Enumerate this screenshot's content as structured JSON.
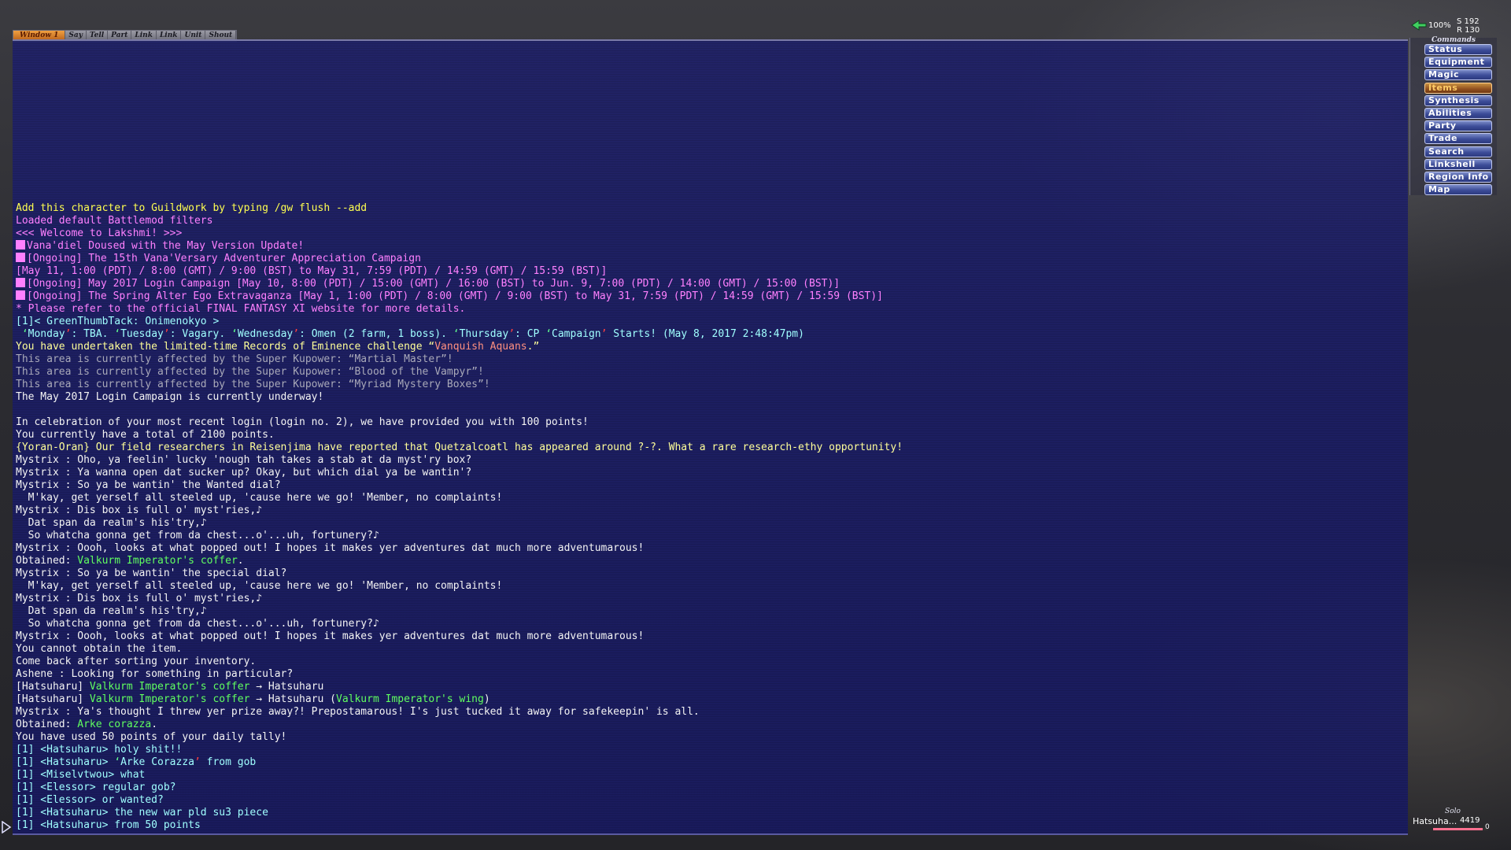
{
  "tabs": [
    {
      "label": "Window 1",
      "active": true
    },
    {
      "label": "Say",
      "active": false
    },
    {
      "label": "Tell",
      "active": false
    },
    {
      "label": "Part",
      "active": false
    },
    {
      "label": "Link",
      "active": false
    },
    {
      "label": "Link",
      "active": false
    },
    {
      "label": "Unit",
      "active": false
    },
    {
      "label": "Shout",
      "active": false
    }
  ],
  "hud": {
    "percent": "100%",
    "s_value": "S 192",
    "r_value": "R 130"
  },
  "commands": {
    "title": "Commands",
    "items": [
      {
        "label": "Status",
        "selected": false
      },
      {
        "label": "Equipment",
        "selected": false
      },
      {
        "label": "Magic",
        "selected": false
      },
      {
        "label": "Items",
        "selected": true
      },
      {
        "label": "Synthesis",
        "selected": false
      },
      {
        "label": "Abilities",
        "selected": false
      },
      {
        "label": "Party",
        "selected": false
      },
      {
        "label": "Trade",
        "selected": false
      },
      {
        "label": "Search",
        "selected": false
      },
      {
        "label": "Linkshell",
        "selected": false
      },
      {
        "label": "Region Info",
        "selected": false
      },
      {
        "label": "Map",
        "selected": false
      }
    ]
  },
  "party": {
    "title": "Solo",
    "name": "Hatsuha...",
    "hp": "4419",
    "hp_fraction": 0.9,
    "tp": "0"
  },
  "chat_lines": [
    {
      "segments": [
        {
          "text": "Add this character to Guildwork by typing /gw flush --add",
          "color": "yellow"
        }
      ]
    },
    {
      "segments": [
        {
          "text": "Loaded default Battlemod filters",
          "color": "magenta"
        }
      ]
    },
    {
      "segments": [
        {
          "text": "<<< Welcome to Lakshmi! >>>",
          "color": "magenta"
        }
      ]
    },
    {
      "bullet": true,
      "segments": [
        {
          "text": "Vana'diel Doused with the May Version Update!",
          "color": "magenta"
        }
      ]
    },
    {
      "bullet": true,
      "segments": [
        {
          "text": "[Ongoing] The 15th Vana'Versary Adventurer Appreciation Campaign",
          "color": "magenta"
        }
      ]
    },
    {
      "segments": [
        {
          "text": "[May 11, 1:00 (PDT) / 8:00 (GMT) / 9:00 (BST) to May 31, 7:59 (PDT) / 14:59 (GMT) / 15:59 (BST)]",
          "color": "magenta"
        }
      ]
    },
    {
      "bullet": true,
      "segments": [
        {
          "text": "[Ongoing] May 2017 Login Campaign [May 10, 8:00 (PDT) / 15:00 (GMT) / 16:00 (BST) to Jun. 9, 7:00 (PDT) / 14:00 (GMT) / 15:00 (BST)]",
          "color": "magenta"
        }
      ]
    },
    {
      "bullet": true,
      "segments": [
        {
          "text": "[Ongoing] The Spring Alter Ego Extravaganza [May 1, 1:00 (PDT) / 8:00 (GMT) / 9:00 (BST) to May 31, 7:59 (PDT) / 14:59 (GMT) / 15:59 (BST)]",
          "color": "magenta"
        }
      ]
    },
    {
      "segments": [
        {
          "text": "* Please refer to the official FINAL FANTASY XI website for more details.",
          "color": "magenta"
        }
      ]
    },
    {
      "segments": [
        {
          "text": "[1]< GreenThumbTack: Onimenokyo >",
          "color": "cyan"
        }
      ]
    },
    {
      "segments": [
        {
          "text": " ",
          "color": "cyan"
        },
        {
          "text": "‘",
          "color": "mag-green"
        },
        {
          "text": "Monday",
          "color": "cyan"
        },
        {
          "text": "’",
          "color": "red"
        },
        {
          "text": ": TBA. ",
          "color": "cyan"
        },
        {
          "text": "‘",
          "color": "mag-green"
        },
        {
          "text": "Tuesday",
          "color": "cyan"
        },
        {
          "text": "’",
          "color": "red"
        },
        {
          "text": ": Vagary. ",
          "color": "cyan"
        },
        {
          "text": "‘",
          "color": "mag-green"
        },
        {
          "text": "Wednesday",
          "color": "cyan"
        },
        {
          "text": "’",
          "color": "red"
        },
        {
          "text": ": Omen (2 farm, 1 boss). ",
          "color": "cyan"
        },
        {
          "text": "‘",
          "color": "mag-green"
        },
        {
          "text": "Thursday",
          "color": "cyan"
        },
        {
          "text": "’",
          "color": "red"
        },
        {
          "text": ": CP ",
          "color": "cyan"
        },
        {
          "text": "‘",
          "color": "mag-green"
        },
        {
          "text": "Campaign",
          "color": "cyan"
        },
        {
          "text": "’",
          "color": "red"
        },
        {
          "text": " Starts! (May 8, 2017 2:48:47pm)",
          "color": "cyan"
        }
      ]
    },
    {
      "segments": [
        {
          "text": "You have undertaken the limited-time Records of Eminence challenge “",
          "color": "lightyellow"
        },
        {
          "text": "Vanquish Aquans",
          "color": "salmon"
        },
        {
          "text": ".”",
          "color": "lightyellow"
        }
      ]
    },
    {
      "segments": [
        {
          "text": "This area is currently affected by the Super Kupower: “Martial Master”!",
          "color": "gray"
        }
      ]
    },
    {
      "segments": [
        {
          "text": "This area is currently affected by the Super Kupower: “Blood of the Vampyr”!",
          "color": "gray"
        }
      ]
    },
    {
      "segments": [
        {
          "text": "This area is currently affected by the Super Kupower: “Myriad Mystery Boxes”!",
          "color": "gray"
        }
      ]
    },
    {
      "segments": [
        {
          "text": "The May 2017 Login Campaign is currently underway!",
          "color": "white"
        }
      ]
    },
    {
      "segments": [
        {
          "text": "",
          "color": "white"
        }
      ]
    },
    {
      "segments": [
        {
          "text": "In celebration of your most recent login (login no. 2), we have provided you with 100 points!",
          "color": "white"
        }
      ]
    },
    {
      "segments": [
        {
          "text": "You currently have a total of 2100 points.",
          "color": "white"
        }
      ]
    },
    {
      "segments": [
        {
          "text": "{Yoran-Oran} Our field researchers in Reisenjima have reported that Quetzalcoatl has appeared around ?-?. What a rare research-ethy opportunity!",
          "color": "lightyellow"
        }
      ]
    },
    {
      "segments": [
        {
          "text": "Mystrix : Oho, ya feelin' lucky 'nough tah takes a stab at da myst'ry box?",
          "color": "white"
        }
      ]
    },
    {
      "segments": [
        {
          "text": "Mystrix : Ya wanna open dat sucker up? Okay, but which dial ya be wantin'?",
          "color": "white"
        }
      ]
    },
    {
      "segments": [
        {
          "text": "Mystrix : So ya be wantin' the Wanted dial?",
          "color": "white"
        }
      ]
    },
    {
      "segments": [
        {
          "text": "  M'kay, get yerself all steeled up, 'cause here we go! 'Member, no complaints!",
          "color": "white"
        }
      ]
    },
    {
      "segments": [
        {
          "text": "Mystrix : Dis box is full o' myst'ries,♪",
          "color": "white"
        }
      ]
    },
    {
      "segments": [
        {
          "text": "  Dat span da realm's his'try,♪",
          "color": "white"
        }
      ]
    },
    {
      "segments": [
        {
          "text": "  So whatcha gonna get from da chest...o'...uh, fortunery?♪",
          "color": "white"
        }
      ]
    },
    {
      "segments": [
        {
          "text": "Mystrix : Oooh, looks at what popped out! I hopes it makes yer adventures dat much more adventumarous!",
          "color": "white"
        }
      ]
    },
    {
      "segments": [
        {
          "text": "Obtained: ",
          "color": "white"
        },
        {
          "text": "Valkurm Imperator's coffer",
          "color": "green"
        },
        {
          "text": ".",
          "color": "white"
        }
      ]
    },
    {
      "segments": [
        {
          "text": "Mystrix : So ya be wantin' the special dial?",
          "color": "white"
        }
      ]
    },
    {
      "segments": [
        {
          "text": "  M'kay, get yerself all steeled up, 'cause here we go! 'Member, no complaints!",
          "color": "white"
        }
      ]
    },
    {
      "segments": [
        {
          "text": "Mystrix : Dis box is full o' myst'ries,♪",
          "color": "white"
        }
      ]
    },
    {
      "segments": [
        {
          "text": "  Dat span da realm's his'try,♪",
          "color": "white"
        }
      ]
    },
    {
      "segments": [
        {
          "text": "  So whatcha gonna get from da chest...o'...uh, fortunery?♪",
          "color": "white"
        }
      ]
    },
    {
      "segments": [
        {
          "text": "Mystrix : Oooh, looks at what popped out! I hopes it makes yer adventures dat much more adventumarous!",
          "color": "white"
        }
      ]
    },
    {
      "segments": [
        {
          "text": "You cannot obtain the item.",
          "color": "white"
        }
      ]
    },
    {
      "segments": [
        {
          "text": "Come back after sorting your inventory.",
          "color": "white"
        }
      ]
    },
    {
      "segments": [
        {
          "text": "Ashene : Looking for something in particular?",
          "color": "white"
        }
      ]
    },
    {
      "segments": [
        {
          "text": "[Hatsuharu] ",
          "color": "white"
        },
        {
          "text": "Valkurm Imperator's coffer",
          "color": "green"
        },
        {
          "text": " → Hatsuharu",
          "color": "white"
        }
      ]
    },
    {
      "segments": [
        {
          "text": "[Hatsuharu] ",
          "color": "white"
        },
        {
          "text": "Valkurm Imperator's coffer",
          "color": "green"
        },
        {
          "text": " → Hatsuharu (",
          "color": "white"
        },
        {
          "text": "Valkurm Imperator's wing",
          "color": "green"
        },
        {
          "text": ")",
          "color": "white"
        }
      ]
    },
    {
      "segments": [
        {
          "text": "Mystrix : Ya's thought I threw yer prize away?! Prepostamarous! I's just tucked it away for safekeepin' is all.",
          "color": "white"
        }
      ]
    },
    {
      "segments": [
        {
          "text": "Obtained: ",
          "color": "white"
        },
        {
          "text": "Arke corazza",
          "color": "green"
        },
        {
          "text": ".",
          "color": "white"
        }
      ]
    },
    {
      "segments": [
        {
          "text": "You have used 50 points of your daily tally!",
          "color": "white"
        }
      ]
    },
    {
      "segments": [
        {
          "text": "[1] <Hatsuharu> holy shit!!",
          "color": "cyan"
        }
      ]
    },
    {
      "segments": [
        {
          "text": "[1] <Hatsuharu> ",
          "color": "cyan"
        },
        {
          "text": "‘",
          "color": "mag-green"
        },
        {
          "text": "Arke Corazza",
          "color": "cyan"
        },
        {
          "text": "’",
          "color": "red"
        },
        {
          "text": " from gob",
          "color": "cyan"
        }
      ]
    },
    {
      "segments": [
        {
          "text": "[1] <Miselvtwou> what",
          "color": "cyan"
        }
      ]
    },
    {
      "segments": [
        {
          "text": "[1] <Elessor> regular gob?",
          "color": "cyan"
        }
      ]
    },
    {
      "segments": [
        {
          "text": "[1] <Elessor> or wanted?",
          "color": "cyan"
        }
      ]
    },
    {
      "segments": [
        {
          "text": "[1] <Hatsuharu> the new war pld su3 piece",
          "color": "cyan"
        }
      ]
    },
    {
      "segments": [
        {
          "text": "[1] <Hatsuharu> from 50 points",
          "color": "cyan"
        }
      ]
    }
  ]
}
